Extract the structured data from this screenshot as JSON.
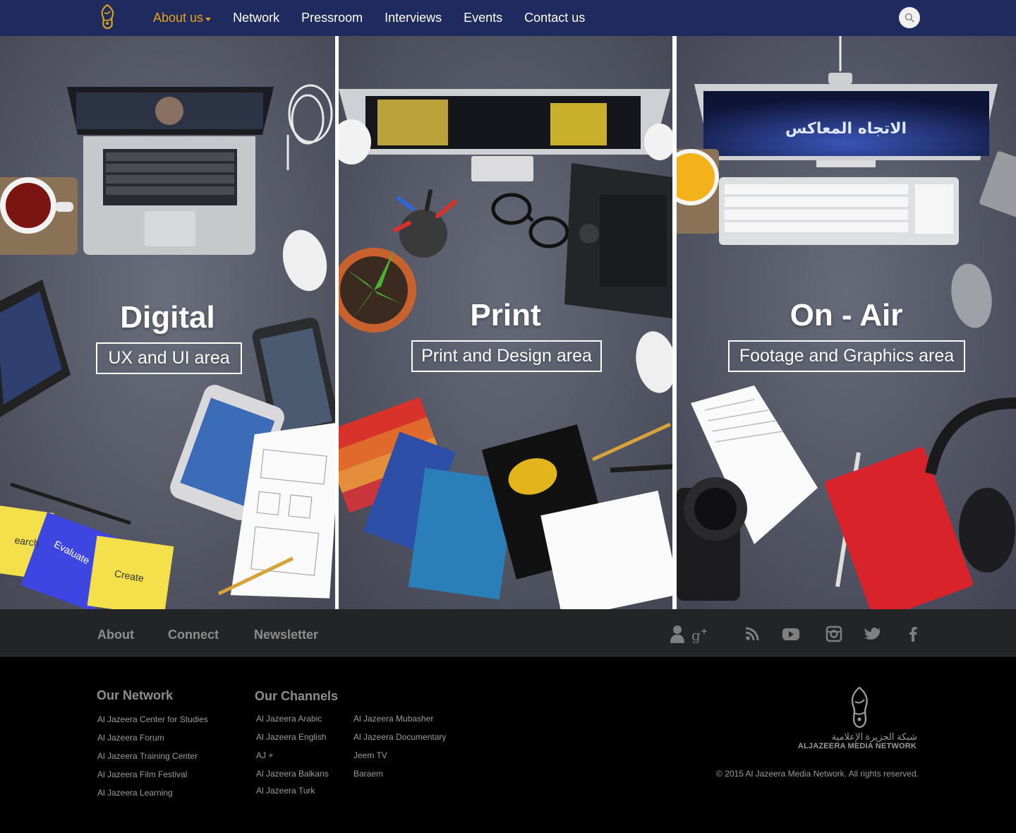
{
  "nav": {
    "logo_icon": "aljazeera-logo-icon",
    "items": [
      {
        "label": "About us",
        "active": true
      },
      {
        "label": "Network"
      },
      {
        "label": "Pressroom"
      },
      {
        "label": "Interviews"
      },
      {
        "label": "Events"
      },
      {
        "label": "Contact us"
      }
    ],
    "search_icon": "search-icon",
    "colors": {
      "bar": "#1f2b5e",
      "active": "#e6a317"
    }
  },
  "panels": [
    {
      "title": "Digital",
      "subtitle": "UX and UI area"
    },
    {
      "title": "Print",
      "subtitle": "Print and Design area"
    },
    {
      "title": "On - Air",
      "subtitle": "Footage and Graphics area"
    }
  ],
  "footer_bar": {
    "links": [
      "About",
      "Connect",
      "Newsletter"
    ],
    "social_icons": [
      "user-icon",
      "google-plus-icon",
      "rss-icon",
      "youtube-icon",
      "instagram-icon",
      "twitter-icon",
      "facebook-icon"
    ]
  },
  "footer": {
    "network": {
      "heading": "Our Network",
      "items": [
        "Al Jazeera Center for Studies",
        "Al Jazeera Forum",
        "Al Jazeera Training Center",
        "Al Jazeera Film Festival",
        "Al Jazeera Learning"
      ]
    },
    "channels": {
      "heading": "Our Channels",
      "col1": [
        "Al Jazeera Arabic",
        "Al Jazeera English",
        "AJ +",
        "Al Jazeera Balkans",
        "Al Jazeera Turk"
      ],
      "col2": [
        "Al Jazeera Mubasher",
        "Al Jazeera Documentary",
        "Jeem TV",
        "Baraem"
      ]
    },
    "brand": {
      "arabic": "شبكة الجزيرة الإعلامية",
      "english": "ALJAZEERA MEDIA NETWORK"
    },
    "copyright": "© 2015 Al Jazeera Media Network. All rights reserved."
  }
}
